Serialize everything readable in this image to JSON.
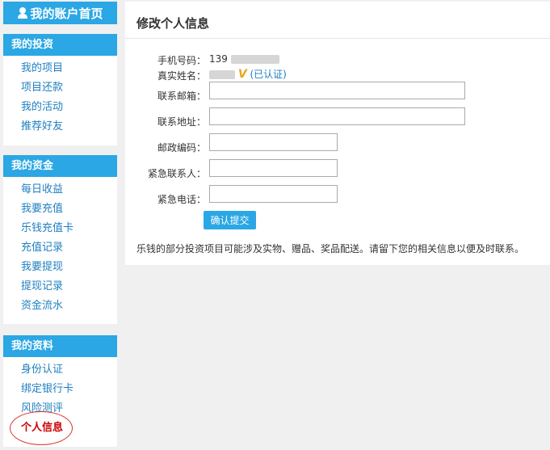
{
  "sidebar": {
    "account_home": "我的账户首页",
    "groups": [
      {
        "title": "我的投资",
        "items": [
          "我的项目",
          "项目还款",
          "我的活动",
          "推荐好友"
        ]
      },
      {
        "title": "我的资金",
        "items": [
          "每日收益",
          "我要充值",
          "乐钱充值卡",
          "充值记录",
          "我要提现",
          "提现记录",
          "资金流水"
        ]
      },
      {
        "title": "我的资料",
        "items": [
          "身份认证",
          "绑定银行卡",
          "风险测评",
          "个人信息"
        ]
      }
    ]
  },
  "main": {
    "title": "修改个人信息",
    "phone_label": "手机号码：",
    "phone_value": "139",
    "name_label": "真实姓名：",
    "vip_mark": "V",
    "verified": "(已认证)",
    "email_label": "联系邮箱：",
    "email_value": "",
    "address_label": "联系地址：",
    "address_value": "",
    "postcode_label": "邮政编码：",
    "postcode_value": "",
    "contact_label": "紧急联系人：",
    "contact_value": "",
    "contact_phone_label": "紧急电话：",
    "contact_phone_value": "",
    "submit": "确认提交",
    "notice": "乐钱的部分投资项目可能涉及实物、赠品、奖品配送。请留下您的相关信息以便及时联系。"
  }
}
